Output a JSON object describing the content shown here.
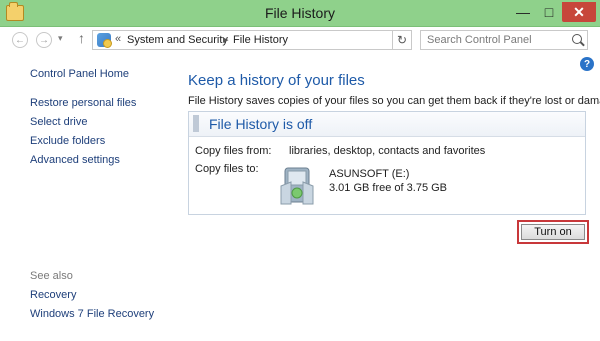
{
  "window": {
    "title": "File History"
  },
  "titlebar_controls": {
    "minimize": "—",
    "maximize": "□",
    "close": "✕"
  },
  "nav": {
    "back_glyph": "←",
    "forward_glyph": "→",
    "recent_glyph": "▾",
    "up_glyph": "↑"
  },
  "address": {
    "prefix": "«",
    "crumbs": [
      "System and Security",
      "File History"
    ],
    "separator": "▸",
    "dropdown_glyph": "▾",
    "refresh_glyph": "↻"
  },
  "search": {
    "placeholder": "Search Control Panel"
  },
  "help": {
    "glyph": "?"
  },
  "sidebar": {
    "home": "Control Panel Home",
    "items": [
      "Restore personal files",
      "Select drive",
      "Exclude folders",
      "Advanced settings"
    ],
    "see_also_label": "See also",
    "see_also": [
      "Recovery",
      "Windows 7 File Recovery"
    ]
  },
  "main": {
    "title": "Keep a history of your files",
    "description": "File History saves copies of your files so you can get them back if they're lost or damaged.",
    "status_title": "File History is off",
    "copy_from_label": "Copy files from:",
    "copy_from_value": "libraries, desktop, contacts and favorites",
    "copy_to_label": "Copy files to:",
    "drive_name": "ASUNSOFT (E:)",
    "drive_free": "3.01 GB free of 3.75 GB",
    "turn_on_label": "Turn on"
  },
  "colors": {
    "titlebar": "#8fd18b",
    "link": "#1e3f7a",
    "heading": "#1e5aa8",
    "highlight_border": "#c8383a",
    "close_button": "#c7463b"
  },
  "icons": {
    "window": "folder-icon",
    "address": "control-panel-icon",
    "drive": "removable-drive-icon",
    "search": "search-icon"
  }
}
